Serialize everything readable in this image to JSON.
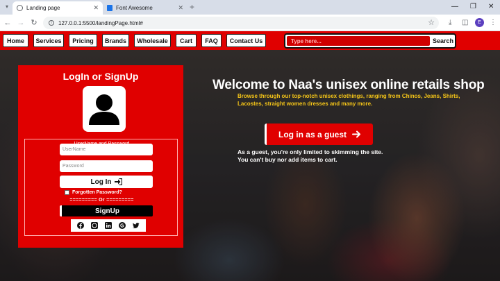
{
  "browser": {
    "tabs": [
      {
        "title": "Landing page",
        "active": true
      },
      {
        "title": "Font Awesome",
        "active": false
      }
    ],
    "new_tab_icon": "plus-icon",
    "url": "127.0.0.1:5500/landingPage.html#",
    "profile_initial": "E"
  },
  "nav": {
    "items": [
      "Home",
      "Services",
      "Pricing",
      "Brands",
      "Wholesale",
      "Cart",
      "FAQ",
      "Contact Us"
    ],
    "search_placeholder": "Type here...",
    "search_button": "Search"
  },
  "login": {
    "title": "LogIn or SignUp",
    "legend": "UserName and Password",
    "username_placeholder": "UserName",
    "password_placeholder": "Password",
    "login_button": "Log In",
    "forgot_label": "Forgotten Password?",
    "divider": "========= Or =========",
    "signup_button": "SignUp",
    "social_icons": [
      "facebook-icon",
      "whatsapp-icon",
      "linkedin-icon",
      "google-icon",
      "twitter-icon"
    ]
  },
  "hero": {
    "title": "Welcome to Naa's unisex online retails shop",
    "subtitle": "Browse through our top-notch unisex clothings, ranging from Chinos, Jeans, Shirts, Lacostes, straight women dresses and many more.",
    "guest_button": "Log in as a guest",
    "guest_note": "As a guest, you're only limited to skimming the site. You can't buy nor add items to cart."
  },
  "colors": {
    "brand_red": "#e00000",
    "accent_yellow": "#f5c518"
  }
}
